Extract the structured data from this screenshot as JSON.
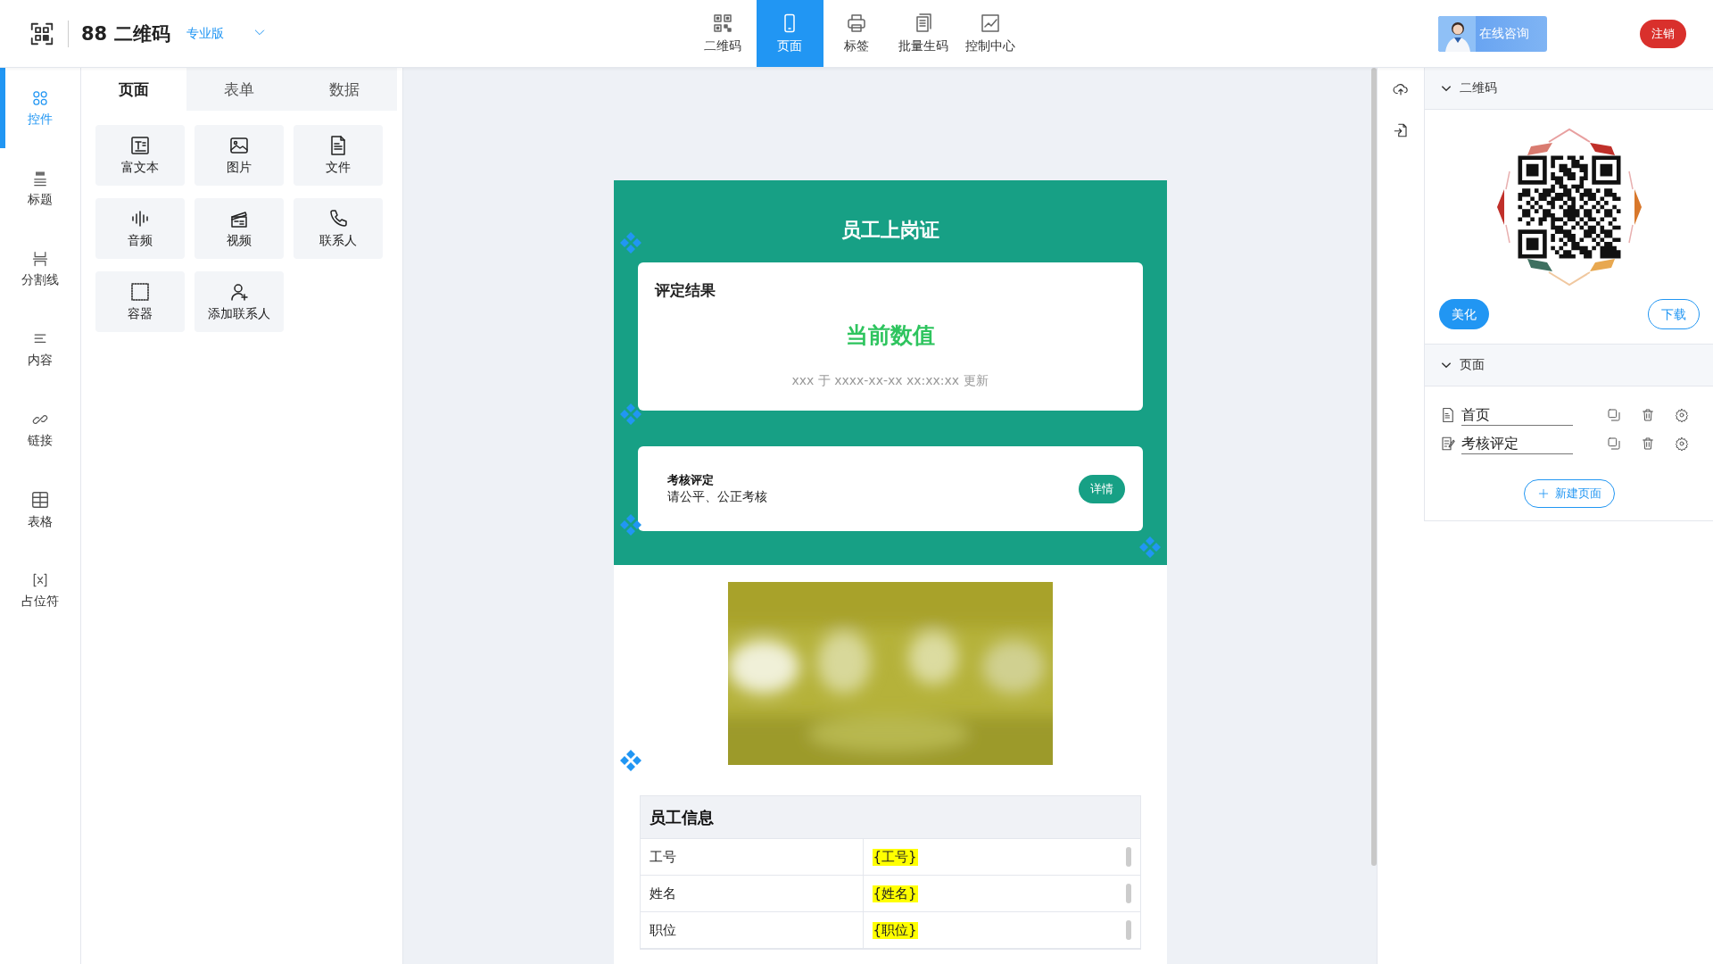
{
  "header": {
    "brand": "88 二维码",
    "edition": "专业版",
    "nav": [
      {
        "label": "二维码",
        "selected": false
      },
      {
        "label": "页面",
        "selected": true
      },
      {
        "label": "标签",
        "selected": false
      },
      {
        "label": "批量生码",
        "selected": false
      },
      {
        "label": "控制中心",
        "selected": false
      }
    ],
    "consult": "在线咨询",
    "logout": "注销"
  },
  "rail": [
    {
      "label": "控件",
      "selected": true
    },
    {
      "label": "标题",
      "selected": false
    },
    {
      "label": "分割线",
      "selected": false
    },
    {
      "label": "内容",
      "selected": false
    },
    {
      "label": "链接",
      "selected": false
    },
    {
      "label": "表格",
      "selected": false
    },
    {
      "label": "占位符",
      "selected": false
    }
  ],
  "widget_tabs": [
    {
      "label": "页面",
      "selected": true
    },
    {
      "label": "表单",
      "selected": false
    },
    {
      "label": "数据",
      "selected": false
    }
  ],
  "widgets": [
    "富文本",
    "图片",
    "文件",
    "音频",
    "视频",
    "联系人",
    "容器",
    "添加联系人"
  ],
  "canvas": {
    "title": "员工上岗证",
    "result_card": {
      "heading": "评定结果",
      "value": "当前数值",
      "note": "xxx 于 xxxx-xx-xx xx:xx:xx 更新"
    },
    "review_card": {
      "title": "考核评定",
      "subtitle": "请公平、公正考核",
      "button": "详情"
    },
    "table": {
      "title": "员工信息",
      "rows": [
        {
          "label": "工号",
          "value": "{工号}"
        },
        {
          "label": "姓名",
          "value": "{姓名}"
        },
        {
          "label": "职位",
          "value": "{职位}"
        }
      ]
    }
  },
  "right_panel": {
    "qr_section": {
      "title": "二维码",
      "expanded": true,
      "buttons": [
        "美化",
        "下载"
      ]
    },
    "pages_section": {
      "title": "页面",
      "expanded": true,
      "pages": [
        {
          "name": "首页"
        },
        {
          "name": "考核评定"
        }
      ],
      "new_button": "新建页面"
    }
  }
}
